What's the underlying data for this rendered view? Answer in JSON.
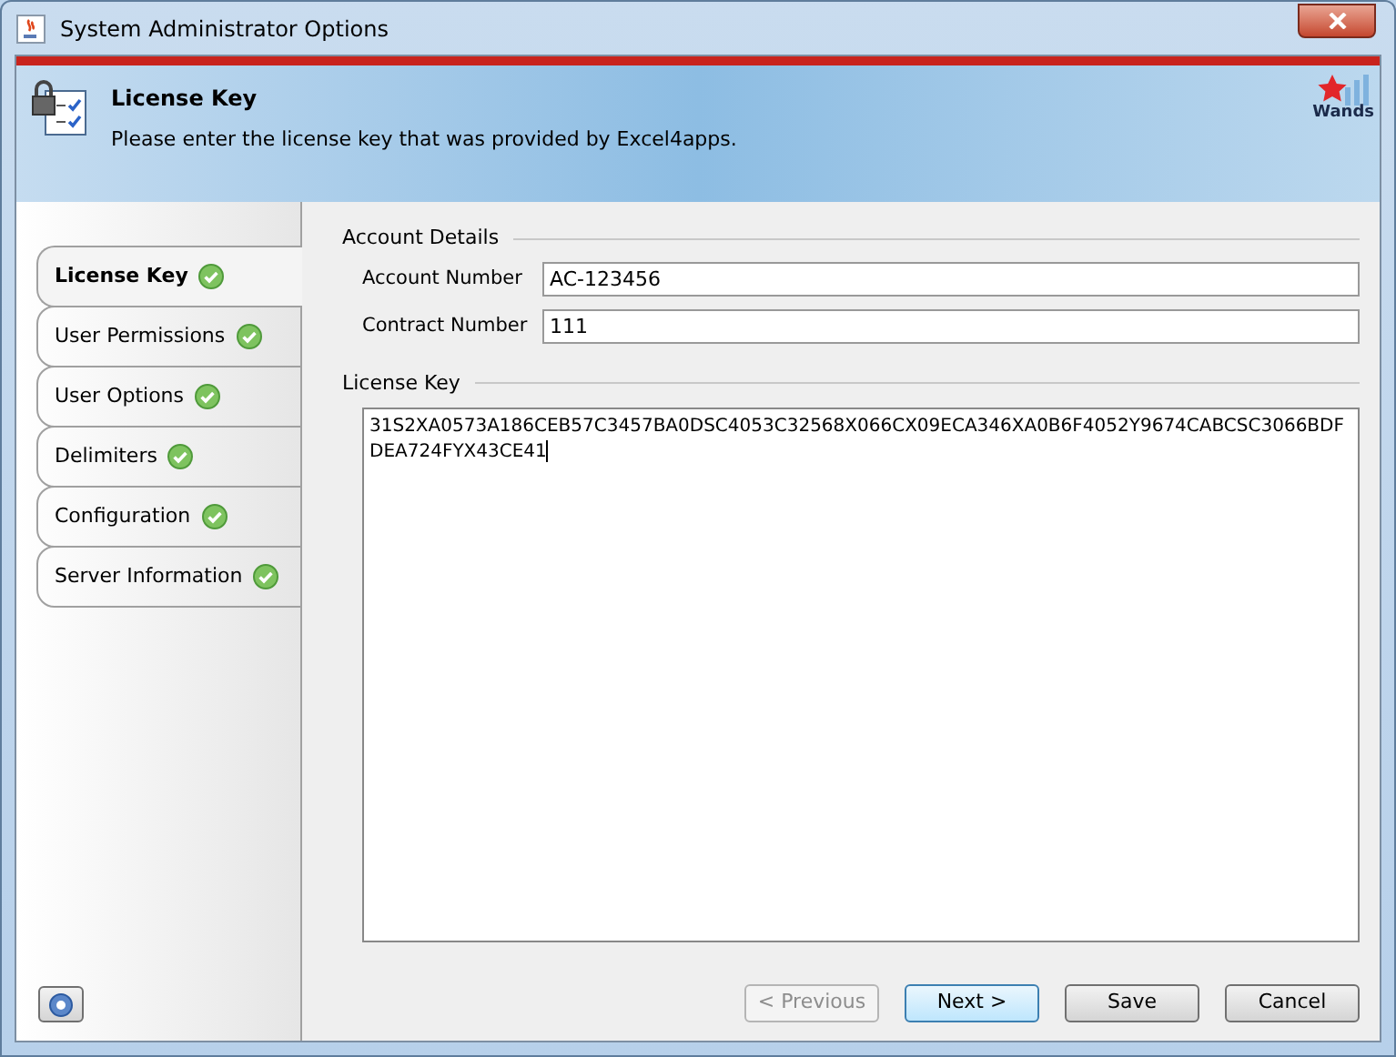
{
  "window": {
    "title": "System Administrator Options"
  },
  "header": {
    "title": "License Key",
    "description": "Please enter the license key that was provided by Excel4apps.",
    "logo_text": "Wands"
  },
  "tabs": [
    {
      "label": "License Key",
      "selected": true,
      "complete": true
    },
    {
      "label": "User Permissions",
      "selected": false,
      "complete": true
    },
    {
      "label": "User Options",
      "selected": false,
      "complete": true
    },
    {
      "label": "Delimiters",
      "selected": false,
      "complete": true
    },
    {
      "label": "Configuration",
      "selected": false,
      "complete": true
    },
    {
      "label": "Server Information",
      "selected": false,
      "complete": true
    }
  ],
  "account_details": {
    "legend": "Account Details",
    "fields": [
      {
        "label": "Account Number",
        "value": "AC-123456"
      },
      {
        "label": "Contract Number",
        "value": "111"
      }
    ]
  },
  "license_key": {
    "legend": "License Key",
    "value": "31S2XA0573A186CEB57C3457BA0DSC4053C32568X066CX09ECA346XA0B6F4052Y9674CABCSC3066BDFDEA724FYX43CE41"
  },
  "buttons": [
    {
      "label": "< Previous",
      "disabled": true,
      "default": false
    },
    {
      "label": "Next >",
      "disabled": false,
      "default": true
    },
    {
      "label": "Save",
      "disabled": false,
      "default": false
    },
    {
      "label": "Cancel",
      "disabled": false,
      "default": false
    }
  ]
}
